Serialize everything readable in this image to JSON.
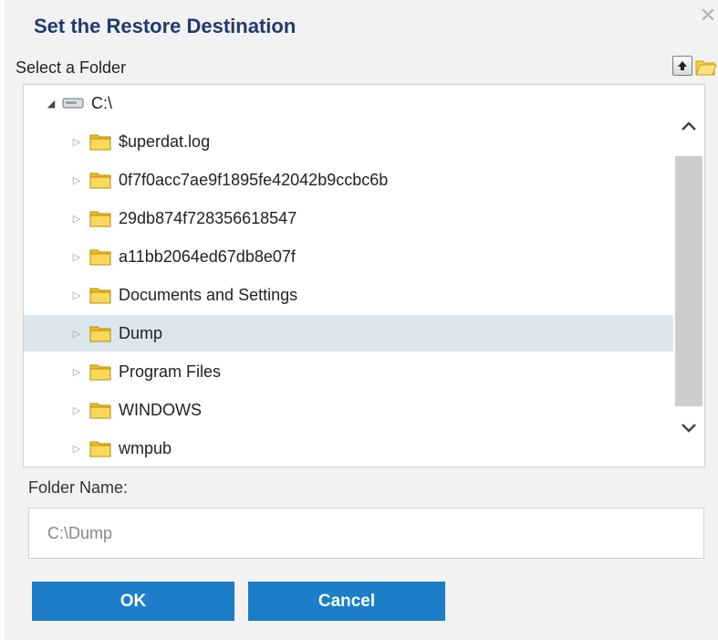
{
  "dialog": {
    "title": "Set the Restore Destination",
    "close_icon": "close-icon"
  },
  "folder_picker": {
    "label": "Select a Folder",
    "icons": [
      "up-arrow-icon",
      "new-folder-icon"
    ]
  },
  "tree": {
    "root": {
      "label": "C:\\",
      "icon": "drive-icon",
      "expanded": true
    },
    "items": [
      {
        "label": "$uperdat.log",
        "icon": "folder-icon",
        "selected": false
      },
      {
        "label": "0f7f0acc7ae9f1895fe42042b9ccbc6b",
        "icon": "folder-icon",
        "selected": false
      },
      {
        "label": "29db874f728356618547",
        "icon": "folder-icon",
        "selected": false
      },
      {
        "label": "a11bb2064ed67db8e07f",
        "icon": "folder-icon",
        "selected": false
      },
      {
        "label": "Documents and Settings",
        "icon": "folder-icon",
        "selected": false
      },
      {
        "label": "Dump",
        "icon": "folder-icon",
        "selected": true
      },
      {
        "label": "Program Files",
        "icon": "folder-icon",
        "selected": false
      },
      {
        "label": "WINDOWS",
        "icon": "folder-icon",
        "selected": false
      },
      {
        "label": "wmpub",
        "icon": "folder-icon",
        "selected": false
      }
    ]
  },
  "folder_name": {
    "label": "Folder Name:",
    "value": "C:\\Dump"
  },
  "buttons": {
    "ok": "OK",
    "cancel": "Cancel"
  },
  "colors": {
    "title": "#1f3a6e",
    "button": "#1c7ec8",
    "selection": "#dbe6ef",
    "folder": "#f5c518"
  }
}
